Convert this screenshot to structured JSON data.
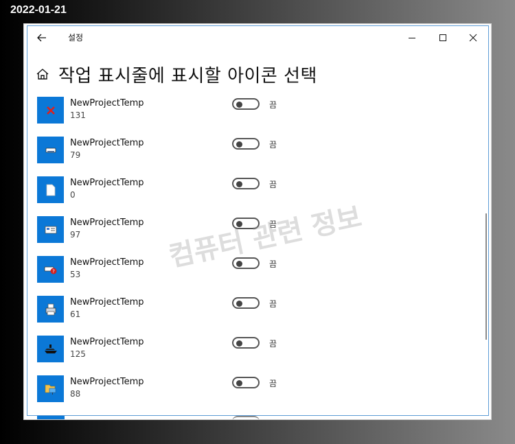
{
  "date_stamp": "2022-01-21",
  "window": {
    "app_title": "설정",
    "page_title": "작업 표시줄에 표시할 아이콘 선택"
  },
  "watermark": "컴퓨터 관련 정보",
  "rows": [
    {
      "name": "NewProjectTemp",
      "sub": "131",
      "state": "끔",
      "icon": "red-x-icon"
    },
    {
      "name": "NewProjectTemp",
      "sub": "79",
      "state": "끔",
      "icon": "drive-icon"
    },
    {
      "name": "NewProjectTemp",
      "sub": "0",
      "state": "끔",
      "icon": "blank-document-icon"
    },
    {
      "name": "NewProjectTemp",
      "sub": "97",
      "state": "끔",
      "icon": "network-card-icon"
    },
    {
      "name": "NewProjectTemp",
      "sub": "53",
      "state": "끔",
      "icon": "drive-error-icon"
    },
    {
      "name": "NewProjectTemp",
      "sub": "61",
      "state": "끔",
      "icon": "printer-icon"
    },
    {
      "name": "NewProjectTemp",
      "sub": "125",
      "state": "끔",
      "icon": "ship-icon"
    },
    {
      "name": "NewProjectTemp",
      "sub": "88",
      "state": "끔",
      "icon": "network-folder-icon"
    }
  ]
}
